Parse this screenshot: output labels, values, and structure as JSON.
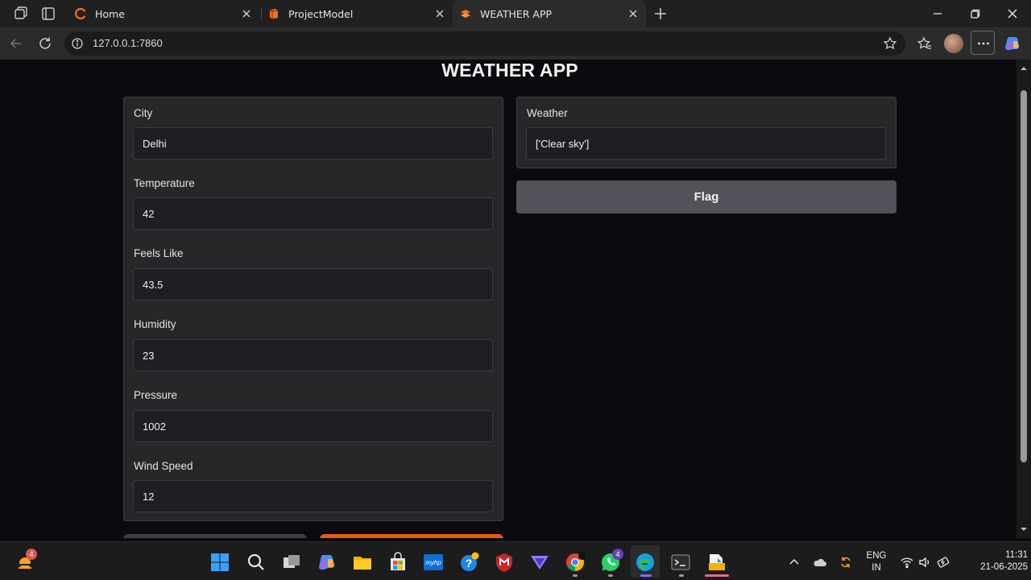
{
  "browser": {
    "tabs": [
      {
        "title": "Home",
        "favicon": "gradio-logo-icon"
      },
      {
        "title": "ProjectModel",
        "favicon": "book-icon"
      },
      {
        "title": "WEATHER APP",
        "favicon": "gradio-logo-icon",
        "active": true
      }
    ],
    "url": "127.0.0.1:7860"
  },
  "app": {
    "title": "WEATHER APP",
    "inputs": [
      {
        "label": "City",
        "value": "Delhi"
      },
      {
        "label": "Temperature",
        "value": "42"
      },
      {
        "label": "Feels Like",
        "value": "43.5"
      },
      {
        "label": "Humidity",
        "value": "23"
      },
      {
        "label": "Pressure",
        "value": "1002"
      },
      {
        "label": "Wind Speed",
        "value": "12"
      }
    ],
    "output": {
      "label": "Weather",
      "value": "['Clear sky']"
    },
    "flag_label": "Flag"
  },
  "taskbar": {
    "widget_badge": "4",
    "whatsapp_badge": "4",
    "lang_line1": "ENG",
    "lang_line2": "IN",
    "time": "11:31",
    "date": "21-06-2025"
  },
  "colors": {
    "accent_orange": "#ea580c",
    "panel_bg": "#27272a",
    "flag_button": "#52525b"
  }
}
